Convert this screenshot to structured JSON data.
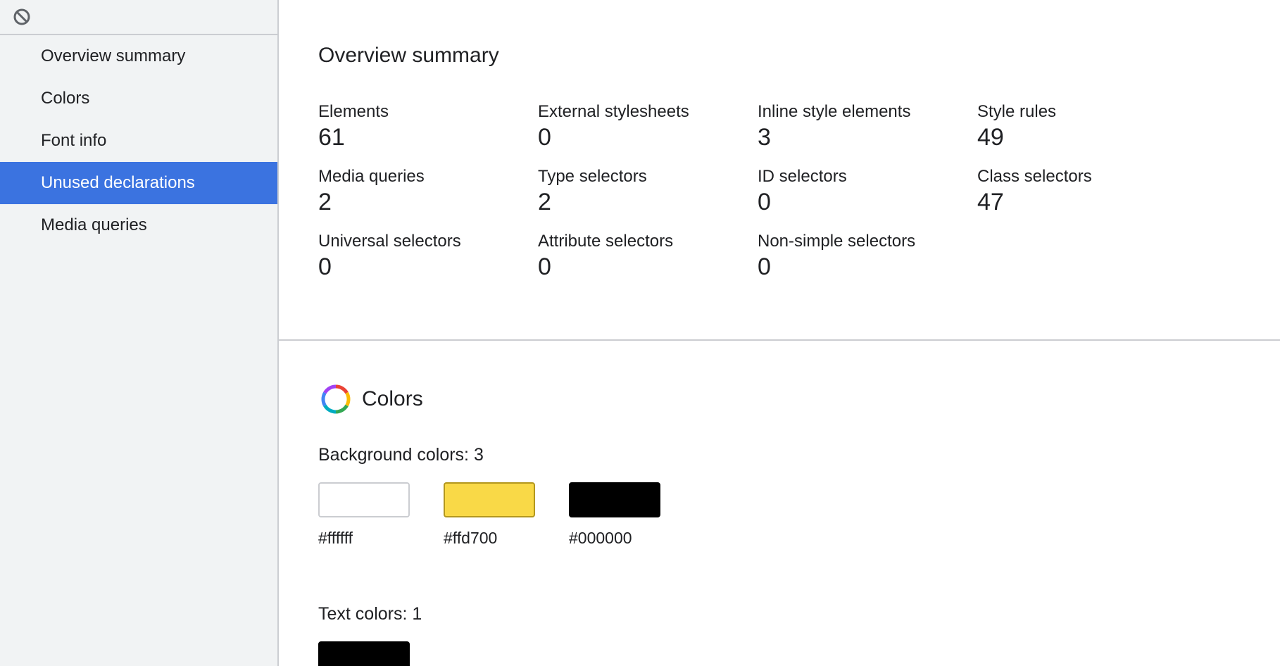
{
  "sidebar": {
    "clear_button_icon": "block-icon",
    "items": [
      {
        "label": "Overview summary",
        "selected": false
      },
      {
        "label": "Colors",
        "selected": false
      },
      {
        "label": "Font info",
        "selected": false
      },
      {
        "label": "Unused declarations",
        "selected": true
      },
      {
        "label": "Media queries",
        "selected": false
      }
    ],
    "selected_color": "#3b73e0"
  },
  "overview": {
    "title": "Overview summary",
    "stats": [
      {
        "label": "Elements",
        "value": "61"
      },
      {
        "label": "External stylesheets",
        "value": "0"
      },
      {
        "label": "Inline style elements",
        "value": "3"
      },
      {
        "label": "Style rules",
        "value": "49"
      },
      {
        "label": "Media queries",
        "value": "2"
      },
      {
        "label": "Type selectors",
        "value": "2"
      },
      {
        "label": "ID selectors",
        "value": "0"
      },
      {
        "label": "Class selectors",
        "value": "47"
      },
      {
        "label": "Universal selectors",
        "value": "0"
      },
      {
        "label": "Attribute selectors",
        "value": "0"
      },
      {
        "label": "Non-simple selectors",
        "value": "0"
      }
    ]
  },
  "colors": {
    "title": "Colors",
    "icon": "color-wheel-icon",
    "background_heading": "Background colors: 3",
    "background_colors": [
      {
        "hex": "#ffffff",
        "label": "#ffffff"
      },
      {
        "hex": "#ffd700",
        "label": "#ffd700"
      },
      {
        "hex": "#000000",
        "label": "#000000"
      }
    ],
    "text_heading": "Text colors: 1",
    "text_colors": [
      {
        "hex": "#000000"
      }
    ]
  }
}
